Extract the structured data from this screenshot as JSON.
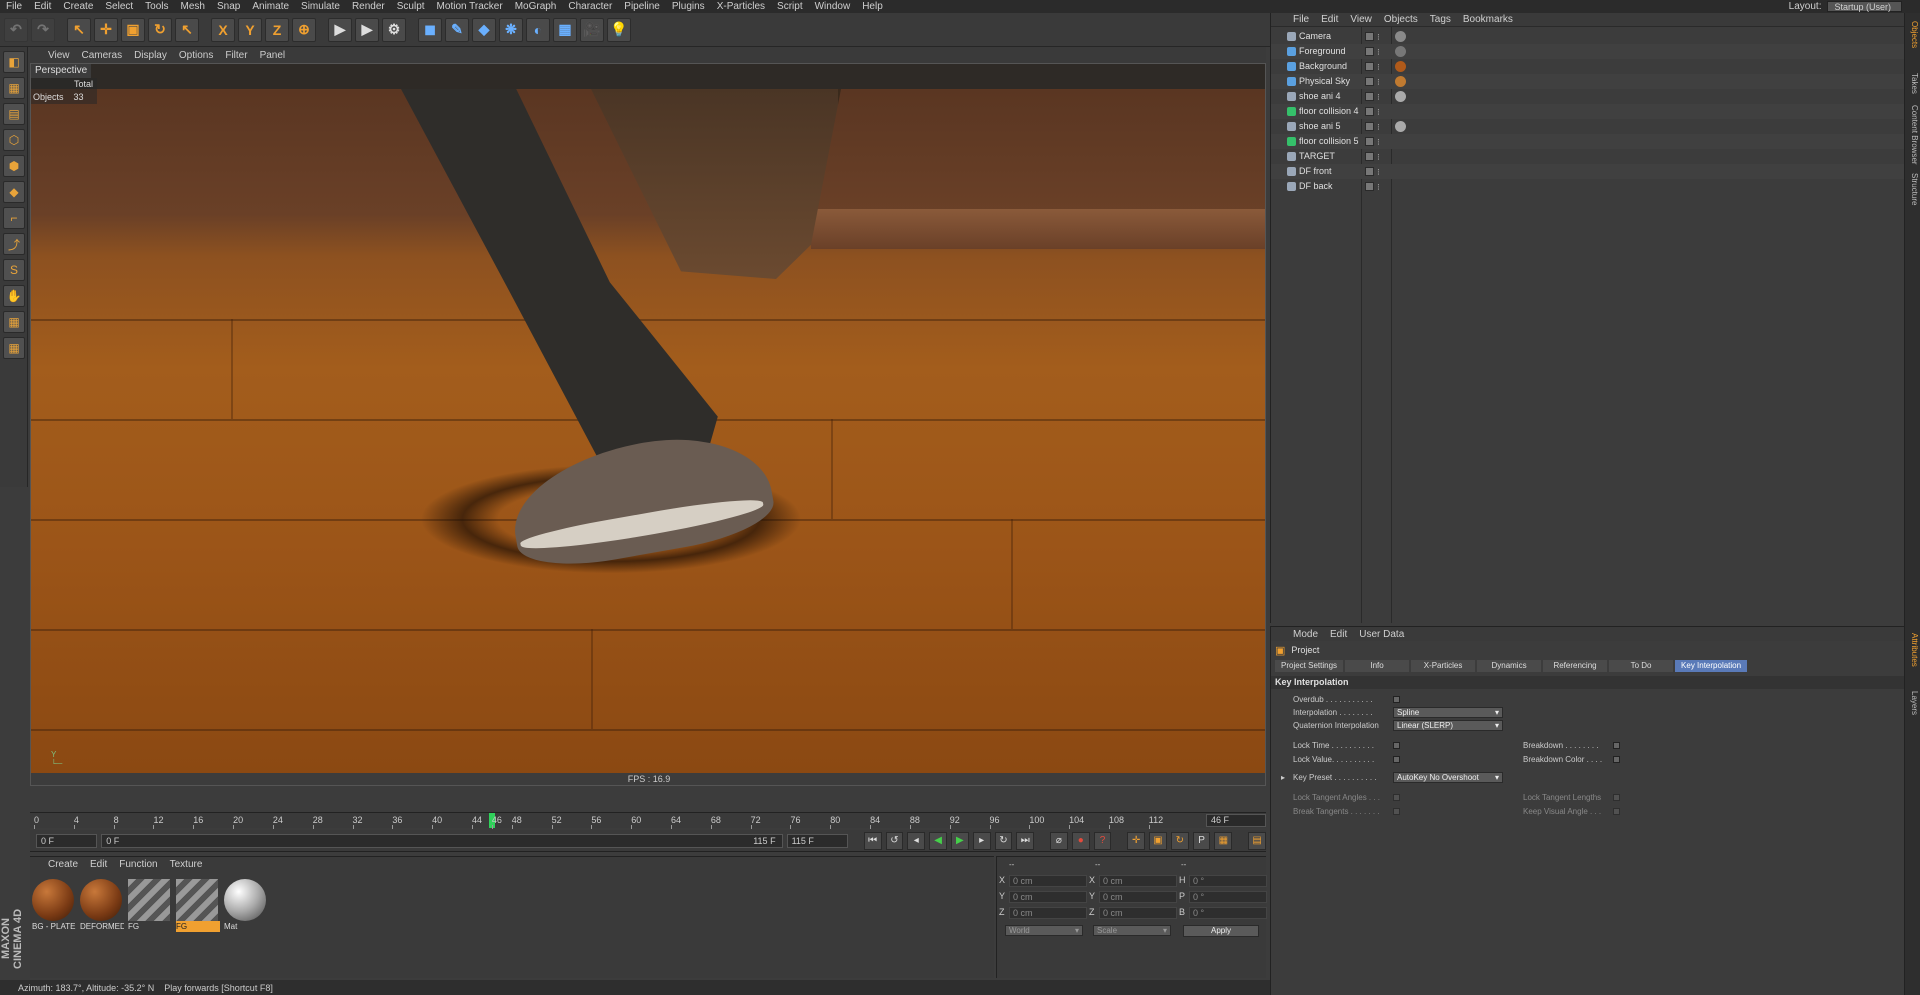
{
  "menubar": {
    "items": [
      "File",
      "Edit",
      "Create",
      "Select",
      "Tools",
      "Mesh",
      "Snap",
      "Animate",
      "Simulate",
      "Render",
      "Sculpt",
      "Motion Tracker",
      "MoGraph",
      "Character",
      "Pipeline",
      "Plugins",
      "X-Particles",
      "Script",
      "Window",
      "Help"
    ],
    "layout_label": "Layout:",
    "layout_value": "Startup (User)"
  },
  "toolbar": {
    "icons": [
      "undo-icon",
      "redo-icon",
      "live-select-icon",
      "move-icon",
      "scale-icon",
      "rotate-icon",
      "last-tool-icon",
      "x-axis-icon",
      "y-axis-icon",
      "z-axis-icon",
      "coordinate-system-icon",
      "render-view-icon",
      "render-picture-viewer-icon",
      "render-settings-icon",
      "cube-icon",
      "pen-icon",
      "subdivision-icon",
      "cloner-icon",
      "deformer-icon",
      "floor-icon",
      "camera-icon",
      "light-icon"
    ],
    "glyphs": [
      "↶",
      "↷",
      "↖",
      "✛",
      "▣",
      "↻",
      "↖",
      "X",
      "Y",
      "Z",
      "⊕",
      "▶",
      "▶",
      "⚙",
      "◼",
      "✎",
      "◆",
      "❋",
      "◐",
      "▦",
      "🎥",
      "💡"
    ]
  },
  "viewport": {
    "menu": [
      "View",
      "Cameras",
      "Display",
      "Options",
      "Filter",
      "Panel"
    ],
    "label": "Perspective",
    "stats_header": "Total",
    "stats_label": "Objects",
    "stats_value": "33",
    "fps": "FPS : 16.9"
  },
  "timeline": {
    "ticks": [
      "0",
      "4",
      "8",
      "12",
      "16",
      "20",
      "24",
      "28",
      "32",
      "36",
      "40",
      "44",
      "46",
      "48",
      "52",
      "56",
      "60",
      "64",
      "68",
      "72",
      "76",
      "80",
      "84",
      "88",
      "92",
      "96",
      "100",
      "104",
      "108",
      "112"
    ],
    "current_frame": "46 F",
    "start_field": "0 F",
    "range_start": "0 F",
    "range_end": "115 F",
    "end_field": "115 F",
    "playhead_frame": 46,
    "max_frame": 115
  },
  "materials": {
    "menu": [
      "Create",
      "Edit",
      "Function",
      "Texture"
    ],
    "items": [
      {
        "label": "BG - PLATE",
        "type": "wood"
      },
      {
        "label": "DEFORMED",
        "type": "wood"
      },
      {
        "label": "FG",
        "type": "stripe"
      },
      {
        "label": "FG",
        "type": "stripe-selected"
      },
      {
        "label": "Mat",
        "type": "grey"
      }
    ]
  },
  "coordinates": {
    "col_headers": [
      "--",
      "--",
      "--"
    ],
    "rows": [
      {
        "a": "X",
        "av": "0 cm",
        "b": "X",
        "bv": "0 cm",
        "c": "H",
        "cv": "0 °"
      },
      {
        "a": "Y",
        "av": "0 cm",
        "b": "Y",
        "bv": "0 cm",
        "c": "P",
        "cv": "0 °"
      },
      {
        "a": "Z",
        "av": "0 cm",
        "b": "Z",
        "bv": "0 cm",
        "c": "B",
        "cv": "0 °"
      }
    ],
    "space": "World",
    "mode": "Scale",
    "apply": "Apply"
  },
  "status": {
    "azimuth": "Azimuth: 183.7°, Altitude: -35.2°  N",
    "hint": "Play forwards [Shortcut F8]"
  },
  "brand": "MAXON CINEMA 4D",
  "objects": {
    "menu": [
      "File",
      "Edit",
      "View",
      "Objects",
      "Tags",
      "Bookmarks"
    ],
    "rows": [
      {
        "name": "Camera",
        "color": "#9aa7b8",
        "tag": "#8a8a8a"
      },
      {
        "name": "Foreground",
        "color": "#5aa0e0",
        "tag": "#777"
      },
      {
        "name": "Background",
        "color": "#5aa0e0",
        "tag": "#b05a1a"
      },
      {
        "name": "Physical Sky",
        "color": "#5aa0e0",
        "tag": "#c07a30"
      },
      {
        "name": "shoe ani 4",
        "color": "#9aa7b8",
        "tag": "#aaaaaa"
      },
      {
        "name": "floor collision 4",
        "color": "#35c06a",
        "tag": ""
      },
      {
        "name": "shoe ani 5",
        "color": "#9aa7b8",
        "tag": "#aaaaaa"
      },
      {
        "name": "floor collision 5",
        "color": "#35c06a",
        "tag": ""
      },
      {
        "name": "TARGET",
        "color": "#9aa7b8",
        "tag": ""
      },
      {
        "name": "DF front",
        "color": "#9aa7b8",
        "tag": ""
      },
      {
        "name": "DF back",
        "color": "#9aa7b8",
        "tag": ""
      }
    ]
  },
  "attributes": {
    "menu": [
      "Mode",
      "Edit",
      "User Data"
    ],
    "title": "Project",
    "tabs": [
      "Project Settings",
      "Info",
      "X-Particles",
      "Dynamics",
      "Referencing",
      "To Do",
      "Key Interpolation"
    ],
    "active_tab": "Key Interpolation",
    "section": "Key Interpolation",
    "params": {
      "overdub": "Overdub . . . . . . . . . . .",
      "interpolation": "Interpolation . . . . . . . .",
      "interpolation_value": "Spline",
      "quaternion": "Quaternion Interpolation",
      "quaternion_value": "Linear (SLERP)",
      "lock_time": "Lock Time . . . . . . . . . .",
      "lock_value": "Lock Value. . . . . . . . . .",
      "breakdown": "Breakdown . . . . . . . .",
      "breakdown_color": "Breakdown Color . . . .",
      "key_preset": "Key Preset . . . . . . . . . .",
      "key_preset_value": "AutoKey No Overshoot",
      "lock_tangent_angles": "Lock Tangent Angles . . .",
      "break_tangents": "Break Tangents . . . . . . .",
      "lock_tangent_lengths": "Lock Tangent Lengths",
      "keep_visual_angle": "Keep Visual Angle . . ."
    }
  },
  "right_tabs": [
    "Objects",
    "Takes",
    "Content Browser",
    "Structure",
    "Attributes",
    "Layers"
  ]
}
